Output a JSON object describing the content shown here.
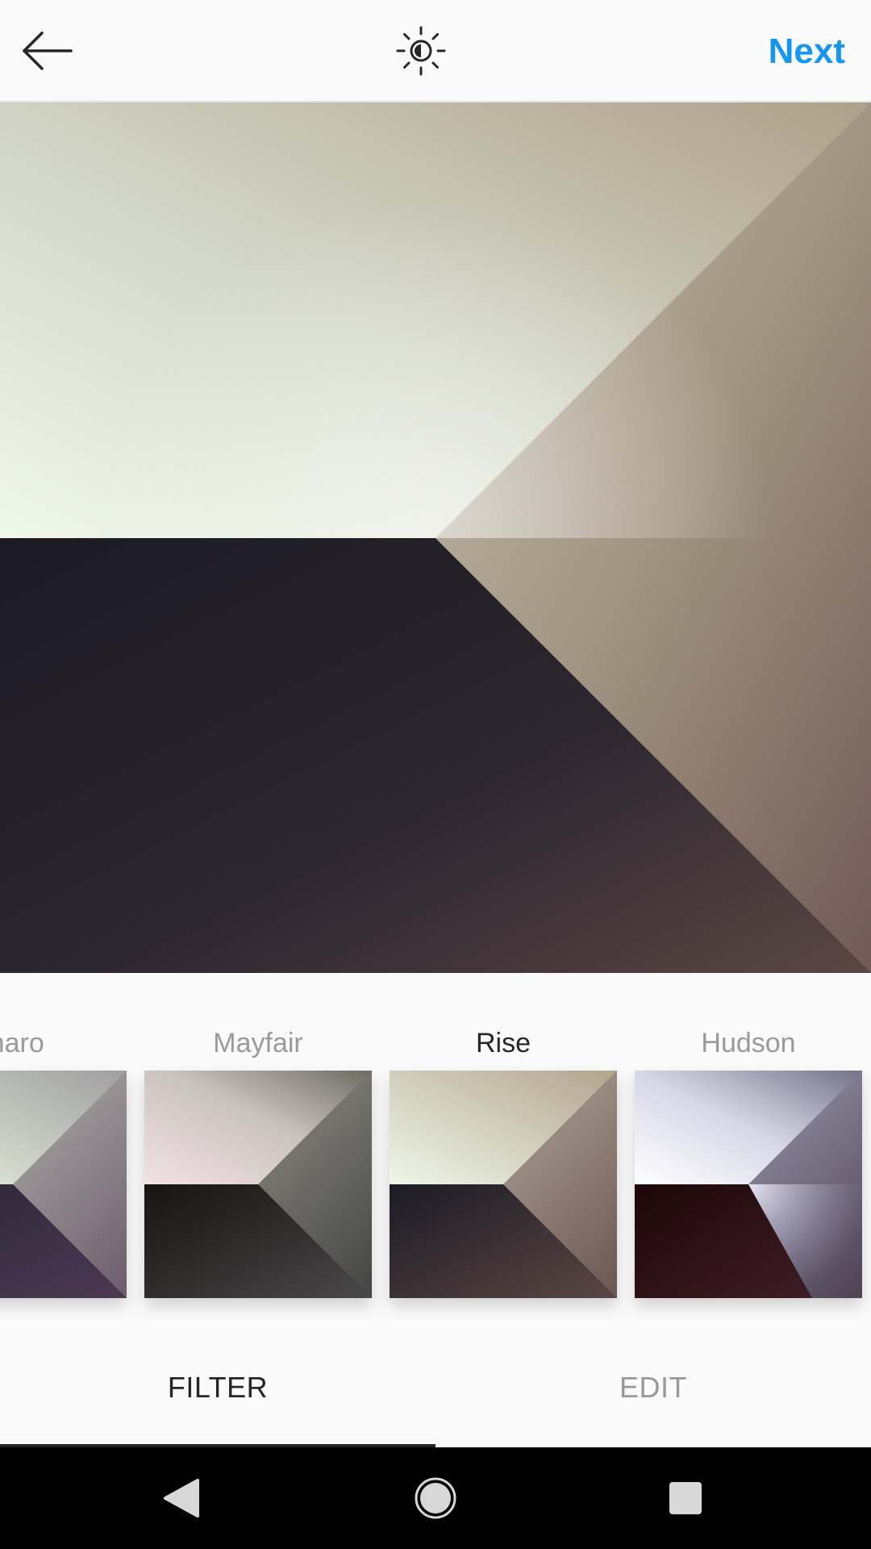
{
  "header": {
    "back_icon": "arrow-left-icon",
    "lux_icon": "lux-brightness-icon",
    "next_label": "Next",
    "accent_color": "#1596f0"
  },
  "preview": {
    "light_color": "#eef6e6",
    "dark_color": "#1c1b26",
    "warm_color": "#6b5552"
  },
  "filters": [
    {
      "label": "maro"
    },
    {
      "label": "Mayfair"
    },
    {
      "label": "Rise",
      "selected": true
    },
    {
      "label": "Hudson"
    }
  ],
  "tabs": {
    "filter_label": "FILTER",
    "edit_label": "EDIT",
    "active": "FILTER"
  },
  "navbar": {
    "back_icon": "nav-back-triangle-icon",
    "home_icon": "nav-home-circle-icon",
    "recents_icon": "nav-recents-square-icon"
  }
}
